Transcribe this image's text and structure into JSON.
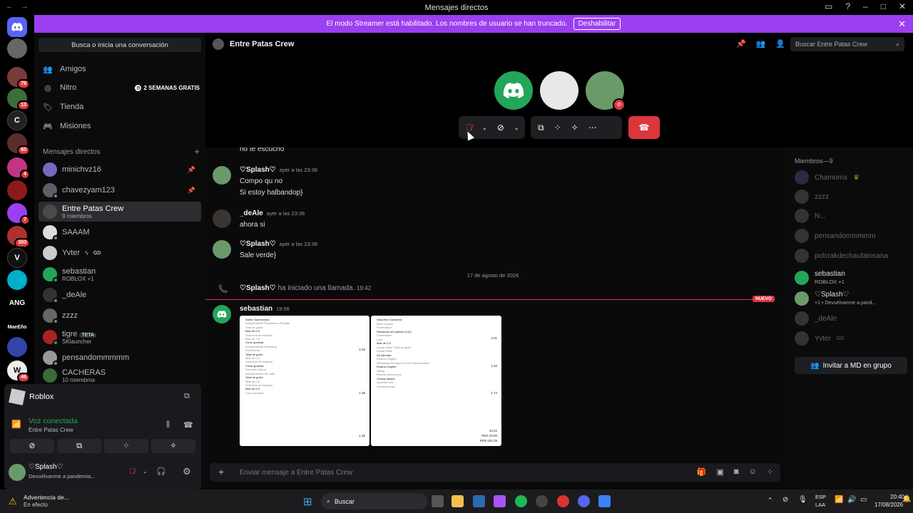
{
  "window": {
    "title": "Mensajes directos"
  },
  "banner": {
    "text": "El modo Streamer está habilitado. Los nombres de usuario se han truncado.",
    "button": "Deshabilitar"
  },
  "guilds": {
    "badges": [
      "79",
      "13",
      "60",
      "4",
      "7",
      "303",
      "ANG",
      "MaeEño",
      "46"
    ],
    "letter_icon": "C"
  },
  "sidebar": {
    "search": "Busca o inicia una conversación",
    "nav": [
      {
        "label": "Amigos",
        "icon": "friends-icon"
      },
      {
        "label": "Nitro",
        "icon": "nitro-icon"
      },
      {
        "label": "Tienda",
        "icon": "shop-icon"
      },
      {
        "label": "Misiones",
        "icon": "quests-icon"
      }
    ],
    "nitro_badge": "2 SEMANAS GRATIS",
    "dm_header": "Mensajes directos",
    "dms": [
      {
        "name": "minichvz16",
        "sub": ""
      },
      {
        "name": "chavezyam123",
        "sub": ""
      },
      {
        "name": "Entre Patas Crew",
        "sub": "9 miembros"
      },
      {
        "name": "SAAAM",
        "sub": ""
      },
      {
        "name": "Yvter",
        "sub": "",
        "tag": "GD"
      },
      {
        "name": "sebastian",
        "sub": "ROBLOX +1"
      },
      {
        "name": "_deAle",
        "sub": ""
      },
      {
        "name": "zzzz",
        "sub": ""
      },
      {
        "name": "tigre",
        "sub": "SKlauncher",
        "tag": "TETA"
      },
      {
        "name": "pensandommmmm",
        "sub": ""
      },
      {
        "name": "CACHERAS",
        "sub": "10 miembros"
      }
    ]
  },
  "voice": {
    "activity": "Roblox",
    "status": "Voz conectada",
    "channel": "Entre Patas Crew",
    "user": "♡Splash♡",
    "user_status": "Devuélvanme a pandemia..."
  },
  "channel": {
    "name": "Entre Patas Crew",
    "search_placeholder": "Buscar Entre Patas Crew"
  },
  "messages": [
    {
      "text": "no te escucho"
    },
    {
      "author": "♡Splash♡",
      "time": "ayer a las 23:36",
      "lines": [
        "Compo qu no",
        "Si estoy halbandop}"
      ]
    },
    {
      "author": "_deAle",
      "time": "ayer a las 23:36",
      "lines": [
        "ahora si"
      ]
    },
    {
      "author": "♡Splash♡",
      "time": "ayer a las 23:36",
      "lines": [
        "Sale verde}"
      ]
    }
  ],
  "divider_date": "17 de agosto de 2026",
  "call_event": {
    "author": "♡Splash♡",
    "text": "ha iniciado una llamada.",
    "time": "19:42"
  },
  "new_label": "NUEVO",
  "last_message": {
    "author": "sebastian",
    "time": "19:56"
  },
  "screenshot1": {
    "items": [
      "Doble Oportunidad",
      "Independiente Rivadavia o Empate",
      "Total de goles",
      "Más de 0.5",
      "Total tiros de esquina",
      "Más de 7.5",
      "Crear apuesta",
      "Independiente Rivadavia",
      "Fluminense",
      "Total de goles",
      "Más de 0.5",
      "Total tiros de esquina",
      "Crear apuesta",
      "Deportes Tolima",
      "Independiente del Valle",
      "Total de goles",
      "Más de 0.5",
      "Total tiros de esquina",
      "Más de 6.5",
      "Crear apuesta"
    ],
    "odds": [
      "2.25",
      "1.36",
      "1.36"
    ]
  },
  "screenshot2": {
    "items": [
      "Deportivo Saravena",
      "Boca Juniors",
      "Fenerbahce",
      "Resultado del partido (1X2)",
      "Fenerbahce",
      "Lyon",
      "Más de 0.5",
      "Levski Sofia: Total de goles",
      "Levski Sofia",
      "AZ Alkmaar",
      "Dinamo Zagreb",
      "Resultado del partido (1X2) Espaciosidad",
      "Dinamo Zagreb",
      "Viking",
      "Repetir selecciones",
      "Cuotas totales",
      "Apuesta total",
      "Ganancia total"
    ],
    "odds": [
      "2.01",
      "1.40",
      "1.74",
      "43.42",
      "PEN 10.00",
      "PEN 434.29"
    ]
  },
  "composer": {
    "placeholder": "Enviar mensaje a Entre Patas Crew"
  },
  "members": {
    "header": "Miembros—9",
    "list": [
      {
        "name": "Chamorrix",
        "online": false
      },
      {
        "name": "zzzz",
        "online": false
      },
      {
        "name": "N...",
        "online": false
      },
      {
        "name": "pensandommmmm",
        "online": false
      },
      {
        "name": "polcrakdechaufainsana",
        "online": false
      },
      {
        "name": "sebastian",
        "sub": "ROBLOX +1",
        "online": true
      },
      {
        "name": "♡Splash♡",
        "sub": "+1 • Devuélvanme a pand...",
        "online": true
      },
      {
        "name": "_deAle",
        "online": false
      },
      {
        "name": "Yvter",
        "sub": "GD",
        "online": false
      }
    ],
    "invite_button": "Invitar a MD en grupo"
  },
  "taskbar": {
    "notification_title": "Advertencia de...",
    "notification_sub": "En efecto",
    "search": "Buscar",
    "lang": "ESP",
    "lang2": "LAA",
    "time": "20:40",
    "date": "17/08/2026"
  },
  "colors": {
    "banner": "#9b3ff0",
    "blurple": "#5865f2",
    "green": "#23a55a",
    "red": "#da373c"
  }
}
